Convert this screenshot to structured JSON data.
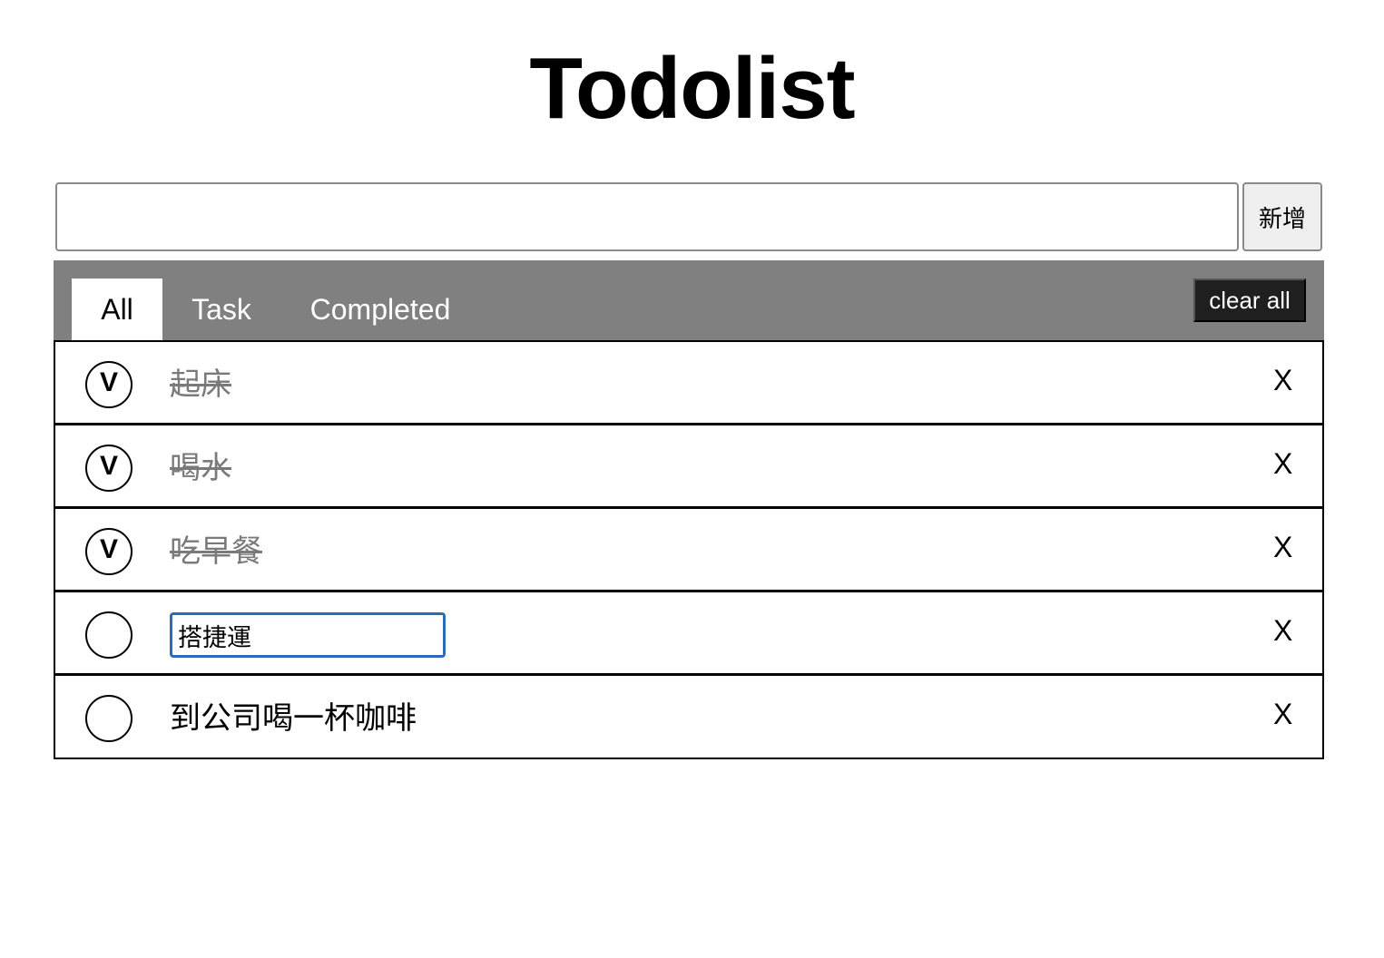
{
  "app": {
    "title": "Todolist"
  },
  "add_form": {
    "input_value": "",
    "input_placeholder": "",
    "add_label": "新增"
  },
  "tabs": [
    {
      "label": "All",
      "active": true
    },
    {
      "label": "Task",
      "active": false
    },
    {
      "label": "Completed",
      "active": false
    }
  ],
  "clear_all_label": "clear all",
  "todos": [
    {
      "text": "起床",
      "done": true,
      "check_mark": "V",
      "delete_label": "X",
      "editing": false
    },
    {
      "text": "喝水",
      "done": true,
      "check_mark": "V",
      "delete_label": "X",
      "editing": false
    },
    {
      "text": "吃早餐",
      "done": true,
      "check_mark": "V",
      "delete_label": "X",
      "editing": false
    },
    {
      "text": "搭捷運",
      "done": false,
      "check_mark": "",
      "delete_label": "X",
      "editing": true
    },
    {
      "text": "到公司喝一杯咖啡",
      "done": false,
      "check_mark": "",
      "delete_label": "X",
      "editing": false
    }
  ],
  "colors": {
    "tab_bar_bg": "#808080",
    "active_tab_bg": "#ffffff",
    "done_text": "#7a7a7a",
    "edit_focus_border": "#2f6ab8",
    "clear_all_bg": "#1f1f1f"
  }
}
